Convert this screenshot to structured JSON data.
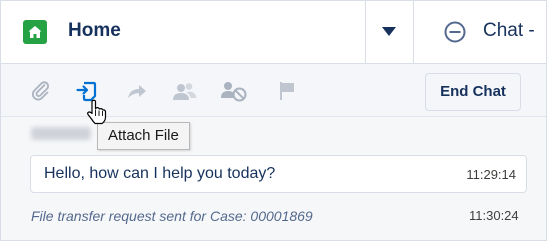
{
  "colors": {
    "brand_blue": "#0070d2",
    "home_green": "#25a244",
    "text_dark": "#16325c",
    "icon_disabled": "#c0c6d0"
  },
  "tabs": {
    "home": {
      "label": "Home",
      "icon": "home-icon"
    },
    "dropdown": {
      "icon": "chevron-down-icon"
    },
    "chat": {
      "label": "Chat -",
      "icon": "minus-circle-icon"
    }
  },
  "toolbar": {
    "icons": [
      "paperclip-icon",
      "attach-file-icon",
      "forward-icon",
      "transfer-users-icon",
      "block-user-icon",
      "flag-icon"
    ],
    "end_chat_label": "End Chat"
  },
  "tooltip": {
    "text": "Attach File"
  },
  "messages": {
    "agent_message": {
      "text": "Hello, how can I help you today?",
      "time": "11:29:14"
    },
    "system_message": {
      "text": "File transfer request sent for Case: 00001869",
      "time": "11:30:24"
    }
  }
}
